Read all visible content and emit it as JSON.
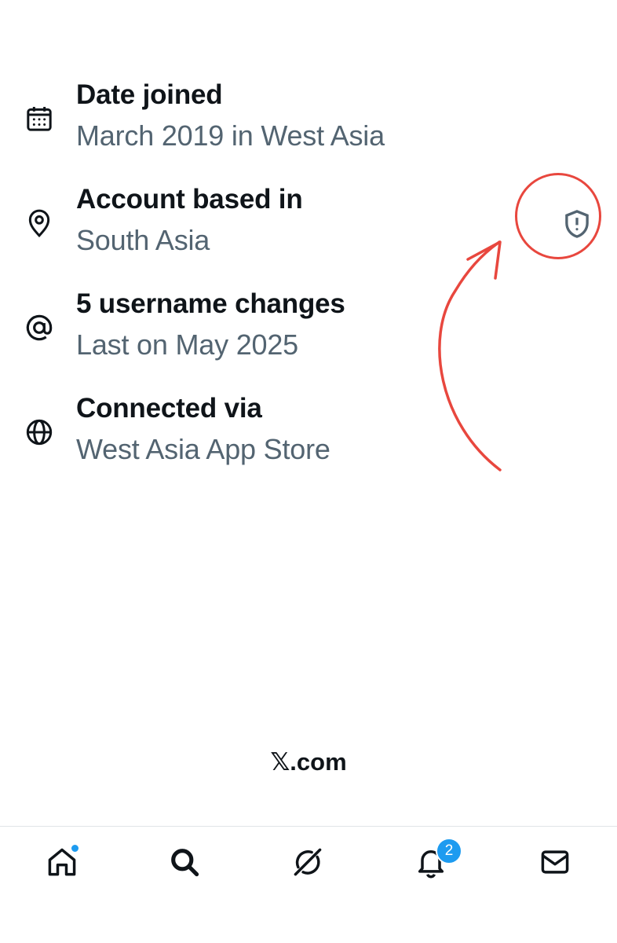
{
  "rows": [
    {
      "icon": "calendar-icon",
      "title": "Date joined",
      "subtitle": "March 2019 in West Asia"
    },
    {
      "icon": "location-pin-icon",
      "title": "Account based in",
      "subtitle": "South Asia"
    },
    {
      "icon": "at-sign-icon",
      "title": "5 username changes",
      "subtitle": "Last on May 2025"
    },
    {
      "icon": "globe-icon",
      "title": "Connected via",
      "subtitle": "West Asia App Store"
    }
  ],
  "shield": {
    "icon": "shield-alert-icon"
  },
  "annotation": {
    "color": "#e8473e"
  },
  "footer": {
    "domain": "𝕏.com"
  },
  "tab_bar": {
    "tabs": [
      {
        "name": "home",
        "icon": "home-icon",
        "has_dot": true
      },
      {
        "name": "search",
        "icon": "search-icon"
      },
      {
        "name": "grok",
        "icon": "grok-icon"
      },
      {
        "name": "notifications",
        "icon": "bell-icon",
        "badge": "2"
      },
      {
        "name": "messages",
        "icon": "mail-icon"
      }
    ]
  },
  "colors": {
    "text_primary": "#0f1419",
    "text_secondary": "#536471",
    "accent": "#1d9bf0"
  }
}
